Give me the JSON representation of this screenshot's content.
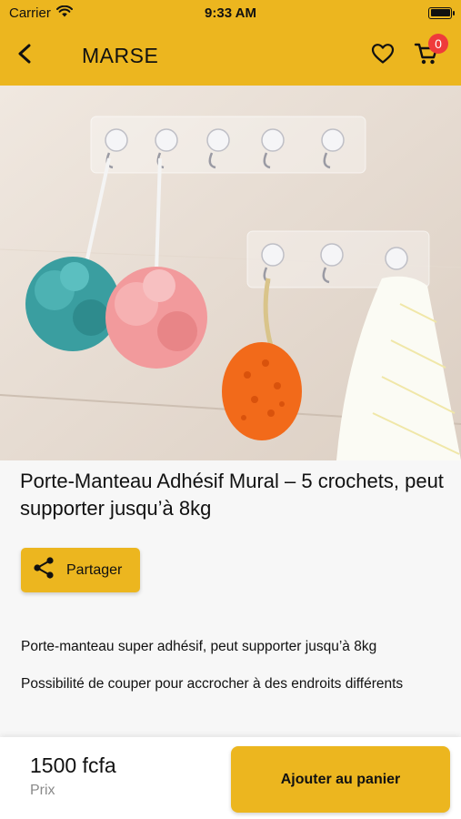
{
  "status_bar": {
    "carrier": "Carrier",
    "time": "9:33 AM"
  },
  "header": {
    "title": "MARSE",
    "cart_count": "0",
    "accent_color": "#ecb61f"
  },
  "product": {
    "title": "Porte-Manteau Adhésif Mural – 5 crochets, peut supporter jusqu’à 8kg",
    "share_label": "Partager",
    "description": [
      "Porte-manteau super adhésif, peut supporter jusqu’à 8kg",
      "Possibilité de couper pour accrocher à des endroits différents"
    ]
  },
  "bottom_bar": {
    "price": "1500 fcfa",
    "price_label": "Prix",
    "add_to_cart_label": "Ajouter au panier"
  },
  "icons": [
    "wifi-icon",
    "battery-icon",
    "back-arrow-icon",
    "heart-icon",
    "cart-icon",
    "share-icon"
  ]
}
